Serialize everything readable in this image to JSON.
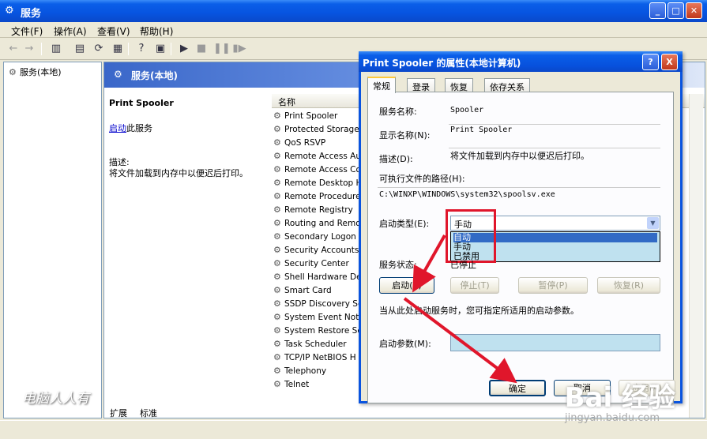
{
  "window": {
    "title": "服务"
  },
  "menu": [
    "文件(F)",
    "操作(A)",
    "查看(V)",
    "帮助(H)"
  ],
  "tree": {
    "root": "服务(本地)"
  },
  "pane": {
    "header": "服务(本地)",
    "service_name": "Print Spooler",
    "start_link": "启动",
    "start_suffix": "此服务",
    "desc_label": "描述:",
    "desc_text": "将文件加载到内存中以便迟后打印。",
    "column_name": "名称",
    "services": [
      "Print Spooler",
      "Protected Storage",
      "QoS RSVP",
      "Remote Access Au",
      "Remote Access Co",
      "Remote Desktop H",
      "Remote Procedure",
      "Remote Registry",
      "Routing and Remo",
      "Secondary Logon",
      "Security Accounts",
      "Security Center",
      "Shell Hardware De",
      "Smart Card",
      "SSDP Discovery Se",
      "System Event Noti",
      "System Restore Se",
      "Task Scheduler",
      "TCP/IP NetBIOS H",
      "Telephony",
      "Telnet"
    ]
  },
  "bottom_tabs": [
    "扩展",
    "标准"
  ],
  "watermark_left": "电脑人人有",
  "watermark_right": "Bai 经验",
  "watermark_url": "jingyan.baidu.com",
  "dialog": {
    "title": "Print Spooler 的属性(本地计算机)",
    "help": "?",
    "close": "X",
    "tabs": [
      "常规",
      "登录",
      "恢复",
      "依存关系"
    ],
    "service_name_label": "服务名称:",
    "service_name_value": "Spooler",
    "display_name_label": "显示名称(N):",
    "display_name_value": "Print Spooler",
    "description_label": "描述(D):",
    "description_value": "将文件加载到内存中以便迟后打印。",
    "path_label": "可执行文件的路径(H):",
    "path_value": "C:\\WINXP\\WINDOWS\\system32\\spoolsv.exe",
    "startup_type_label": "启动类型(E):",
    "startup_type_value": "手动",
    "startup_options": [
      "自动",
      "手动",
      "已禁用"
    ],
    "startup_selected": "自动",
    "status_label": "服务状态:",
    "status_value": "已停止",
    "buttons": {
      "start": "启动(S)",
      "stop": "停止(T)",
      "pause": "暂停(P)",
      "resume": "恢复(R)"
    },
    "hint": "当从此处启动服务时，您可指定所适用的启动参数。",
    "params_label": "启动参数(M):",
    "ok": "确定",
    "cancel": "取消",
    "apply": "应用(A)"
  },
  "colors": {
    "title_blue": "#0a5ee8",
    "highlight": "#e0162b",
    "selection": "#316ac5"
  }
}
